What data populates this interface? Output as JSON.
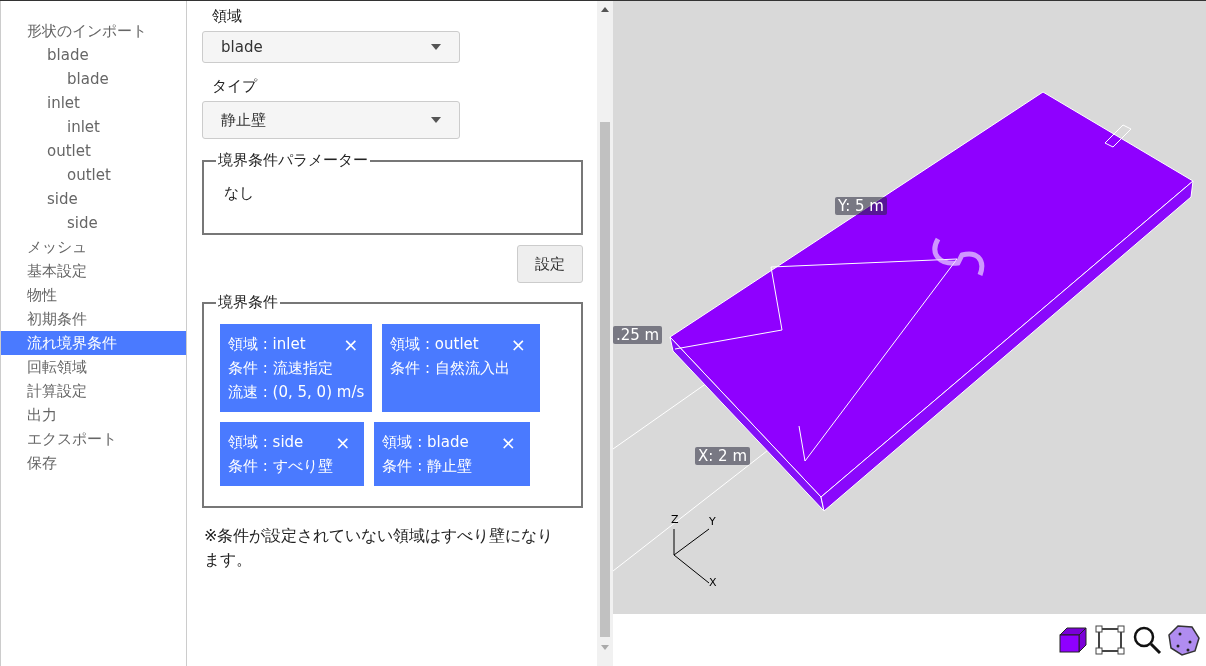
{
  "sidebar": {
    "items": [
      {
        "label": "形状のインポート",
        "selected": false,
        "children": [
          {
            "label": "blade",
            "selected": false,
            "children": [
              {
                "label": "blade",
                "selected": false
              }
            ]
          },
          {
            "label": "inlet",
            "selected": false,
            "children": [
              {
                "label": "inlet",
                "selected": false
              }
            ]
          },
          {
            "label": "outlet",
            "selected": false,
            "children": [
              {
                "label": "outlet",
                "selected": false
              }
            ]
          },
          {
            "label": "side",
            "selected": false,
            "children": [
              {
                "label": "side",
                "selected": false
              }
            ]
          }
        ]
      },
      {
        "label": "メッシュ",
        "selected": false
      },
      {
        "label": "基本設定",
        "selected": false
      },
      {
        "label": "物性",
        "selected": false
      },
      {
        "label": "初期条件",
        "selected": false
      },
      {
        "label": "流れ境界条件",
        "selected": true
      },
      {
        "label": "回転領域",
        "selected": false
      },
      {
        "label": "計算設定",
        "selected": false
      },
      {
        "label": "出力",
        "selected": false
      },
      {
        "label": "エクスポート",
        "selected": false
      },
      {
        "label": "保存",
        "selected": false
      }
    ]
  },
  "form": {
    "region_label": "領域",
    "region_value": "blade",
    "type_label": "タイプ",
    "type_value": "静止壁",
    "params": {
      "legend": "境界条件パラメーター",
      "text": "なし"
    },
    "set_button": "設定",
    "conditions": {
      "legend": "境界条件",
      "cards": [
        {
          "lines": [
            "領域 : inlet",
            "条件 : 流速指定",
            "流速 : (0, 5, 0) m/s"
          ],
          "close": "×"
        },
        {
          "lines": [
            "領域 : outlet",
            "条件 : 自然流入出"
          ],
          "close": "×"
        },
        {
          "lines": [
            "領域 : side",
            "条件 : すべり壁"
          ],
          "close": "×"
        },
        {
          "lines": [
            "領域 : blade",
            "条件 : 静止壁"
          ],
          "close": "×"
        }
      ]
    },
    "note": "※条件が設定されていない領域はすべり壁になります。"
  },
  "viewport": {
    "dim_y": "Y: 5 m",
    "dim_z": ".25 m",
    "dim_x": "X: 2 m",
    "axes": {
      "z": "Z",
      "y": "Y",
      "x": "X"
    }
  }
}
